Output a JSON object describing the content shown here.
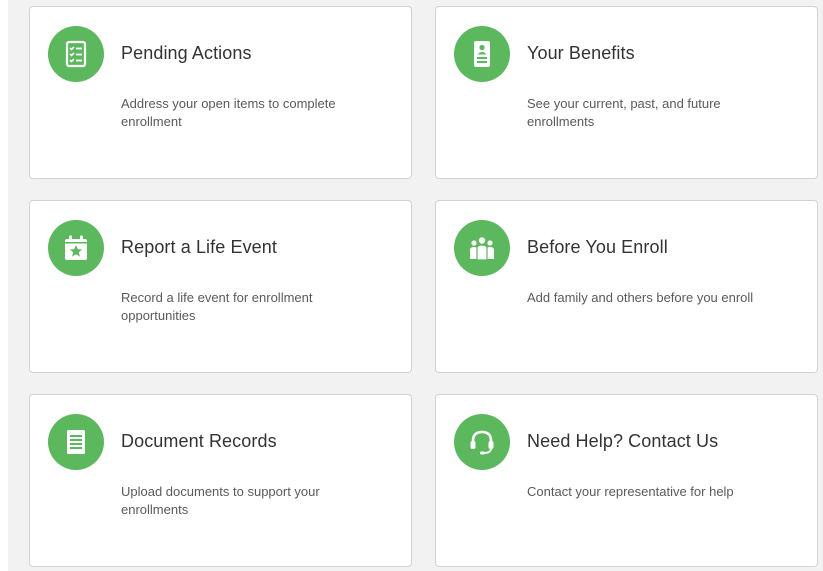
{
  "colors": {
    "accent": "#5cb85c",
    "card_border": "#cfd3d7",
    "page_background": "#f2f2f2"
  },
  "cards": [
    {
      "title": "Pending Actions",
      "description": "Address your open items to complete enrollment",
      "icon": "checklist-icon"
    },
    {
      "title": "Your Benefits",
      "description": "See your current, past, and future enrollments",
      "icon": "id-badge-icon"
    },
    {
      "title": "Report a Life Event",
      "description": "Record a life event for enrollment opportunities",
      "icon": "calendar-star-icon"
    },
    {
      "title": "Before You Enroll",
      "description": "Add family and others before you enroll",
      "icon": "family-group-icon"
    },
    {
      "title": "Document Records",
      "description": "Upload documents to support your enrollments",
      "icon": "document-icon"
    },
    {
      "title": "Need Help? Contact Us",
      "description": "Contact your representative for help",
      "icon": "headset-icon"
    }
  ]
}
